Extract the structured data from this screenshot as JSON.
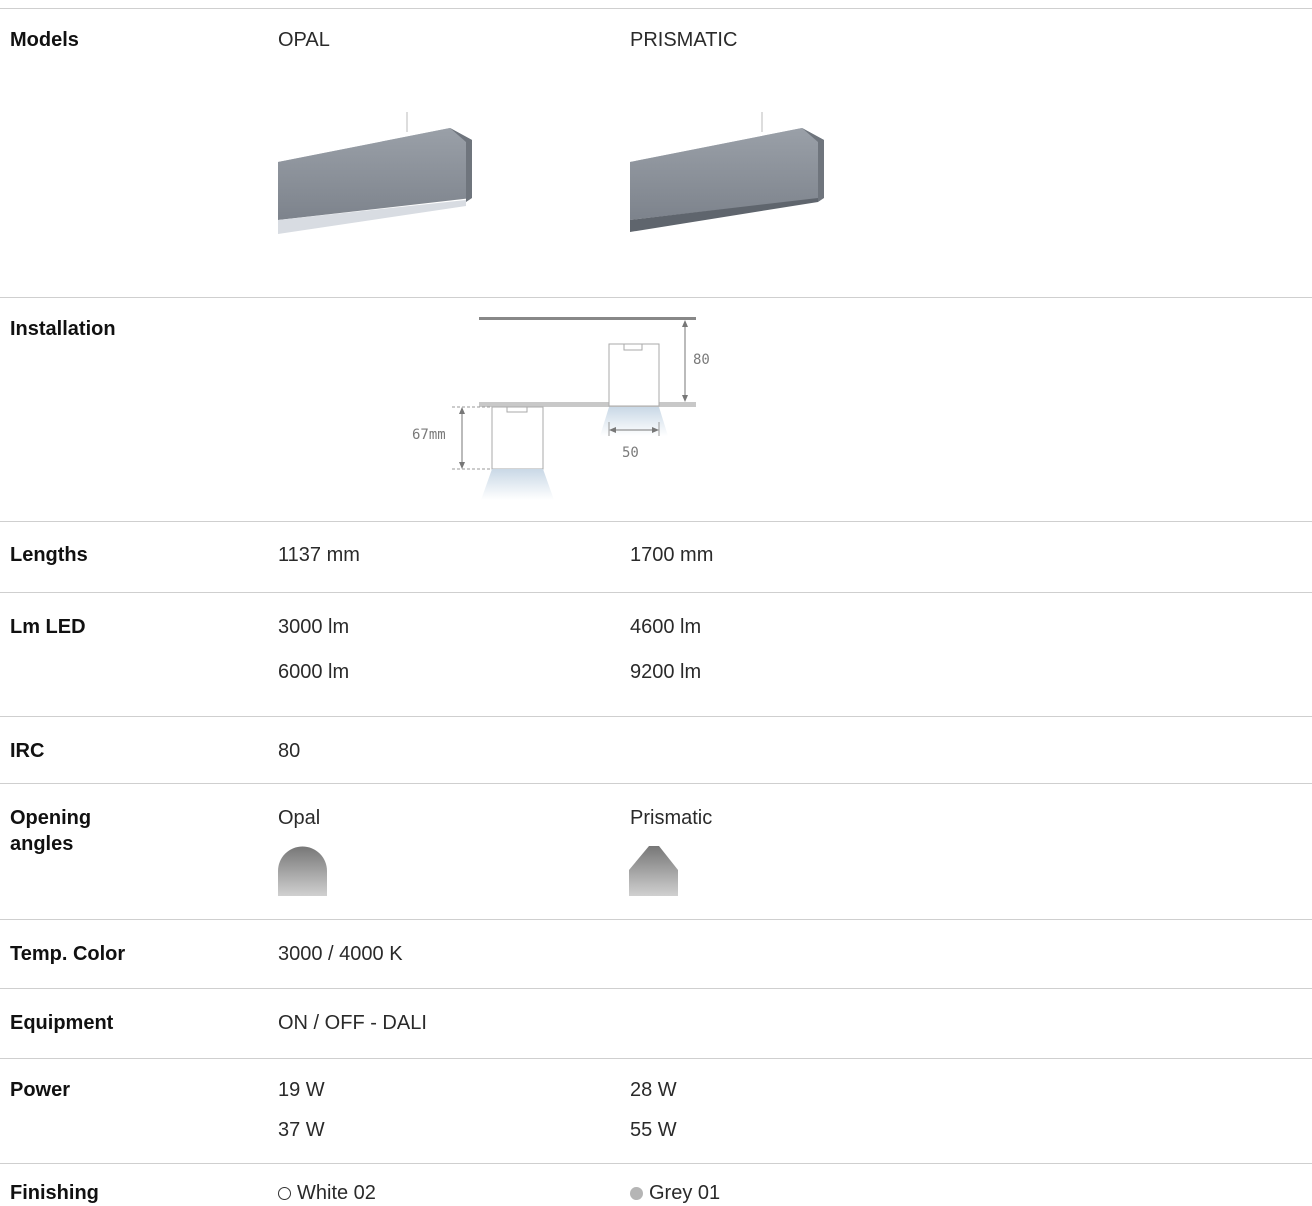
{
  "rows": {
    "models": {
      "label": "Models",
      "col1": "OPAL",
      "col2": "PRISMATIC"
    },
    "installation": {
      "label": "Installation",
      "dim_height_left": "67mm",
      "dim_height_right": "80",
      "dim_width": "50"
    },
    "lengths": {
      "label": "Lengths",
      "col1": "1137 mm",
      "col2": "1700 mm"
    },
    "lm_led": {
      "label": "Lm LED",
      "col1": [
        "3000 lm",
        "6000 lm"
      ],
      "col2": [
        "4600 lm",
        "9200 lm"
      ]
    },
    "irc": {
      "label": "IRC",
      "col1": "80"
    },
    "opening": {
      "label_line1": "Opening",
      "label_line2": "angles",
      "col1": "Opal",
      "col2": "Prismatic"
    },
    "temp": {
      "label": "Temp. Color",
      "col1": "3000 / 4000 K"
    },
    "equipment": {
      "label": "Equipment",
      "col1": "ON / OFF - DALI"
    },
    "power": {
      "label": "Power",
      "col1": [
        "19 W",
        "37 W"
      ],
      "col2": [
        "28 W",
        "55 W"
      ]
    },
    "finishing": {
      "label": "Finishing",
      "col1": "White 02",
      "col2": "Grey 01"
    }
  },
  "colors": {
    "divider": "#cfcfcf",
    "luminaire": "#8a9098",
    "grey_swatch": "#b5b5b5"
  }
}
